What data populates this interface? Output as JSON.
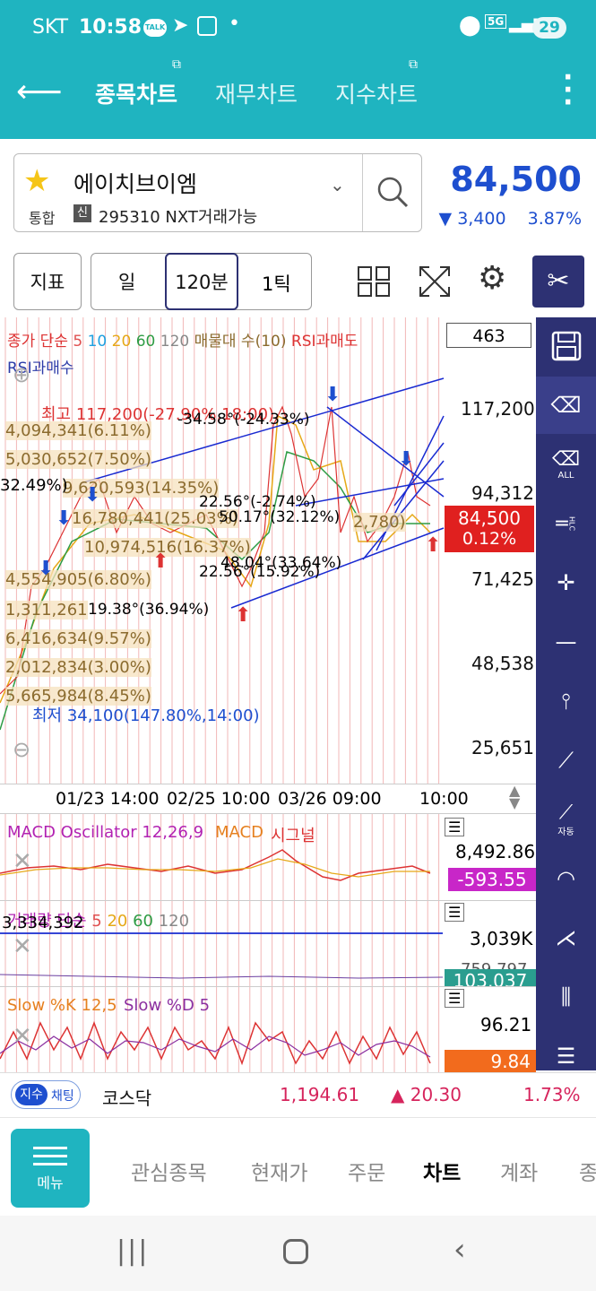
{
  "status": {
    "carrier": "SKT",
    "time": "10:58",
    "talk": "TALK",
    "net": "5G",
    "battery": "29"
  },
  "tabs": [
    {
      "label": "종목차트",
      "active": true
    },
    {
      "label": "재무차트",
      "active": false
    },
    {
      "label": "지수차트",
      "active": false
    }
  ],
  "stock": {
    "name": "에이치브이엠",
    "market": "통합",
    "credit_badge": "신",
    "code_info": "295310 NXT거래가능",
    "price": "84,500",
    "change": "▼ 3,400",
    "change_pct": "3.87%"
  },
  "toolbar": {
    "indicator": "지표",
    "day": "일",
    "minutes": "120분",
    "tick": "1틱"
  },
  "chart": {
    "count_box": "463",
    "legend_line1": [
      "종가 단순",
      "5",
      "10",
      "20",
      "60",
      "120",
      "매물대 수(10)",
      "RSI과매도"
    ],
    "legend_line2": "RSI과매수",
    "y_labels": [
      "117,200",
      "94,312",
      "71,425",
      "48,538",
      "25,651"
    ],
    "price_tag": "84,500",
    "price_tag_pct": "0.12%",
    "high_label": "최고 117,200(-27.90%,18:00)",
    "low_label": "최저 34,100(147.80%,14:00)",
    "volume_profile": [
      "4,094,341(6.11%)",
      "5,030,652(7.50%)",
      "9,620,593(14.35%)",
      "16,780,441(25.03%)",
      "10,974,516(16.37%)",
      "4,554,905(6.80%)",
      "1,311,261",
      "6,416,634(9.57%)",
      "2,012,834(3.00%)",
      "5,665,984(8.45%)"
    ],
    "vp_left_pct": "32.49%)",
    "vp_right_val": "2,780)",
    "angle_labels": [
      "-34.58°(-24.33%)",
      "22.56°(-2.74%)",
      "50.17°(32.12%)",
      "48.04°(33.64%)",
      "22.56°(15.92%)",
      "19.38°(36.94%)"
    ],
    "x_labels": [
      "01/23 14:00",
      "02/25 10:00",
      "03/26 09:00",
      "10:00"
    ]
  },
  "macd": {
    "title": "MACD Oscillator 12,26,9",
    "macd": "MACD",
    "signal": "시그널",
    "top": "8,492.86",
    "tag": "-593.55"
  },
  "volume": {
    "title_a": "거래량 단순",
    "p5": "5",
    "p20": "20",
    "p60": "60",
    "p120": "120",
    "left": "3,334,392",
    "top": "3,039K",
    "mid": "759,797",
    "tag": "103,037"
  },
  "slow": {
    "k": "Slow %K 12,5",
    "d": "Slow %D 5",
    "top": "96.21",
    "tag": "9.84"
  },
  "index": {
    "badge1": "지수",
    "badge2": "채팅",
    "name": "코스닥",
    "value": "1,194.61",
    "change": "▲ 20.30",
    "pct": "1.73%"
  },
  "nav": {
    "menu": "메뉴",
    "items": [
      "관심종목",
      "현재가",
      "주문",
      "차트",
      "계좌",
      "종"
    ],
    "active": "차트"
  },
  "panel": {
    "all": "ALL",
    "auto": "자동",
    "hlc": "HLC"
  },
  "colors": {
    "teal": "#1fb4c0",
    "up": "#e02424",
    "down": "#1e4fcf",
    "panel": "#2d3173"
  }
}
